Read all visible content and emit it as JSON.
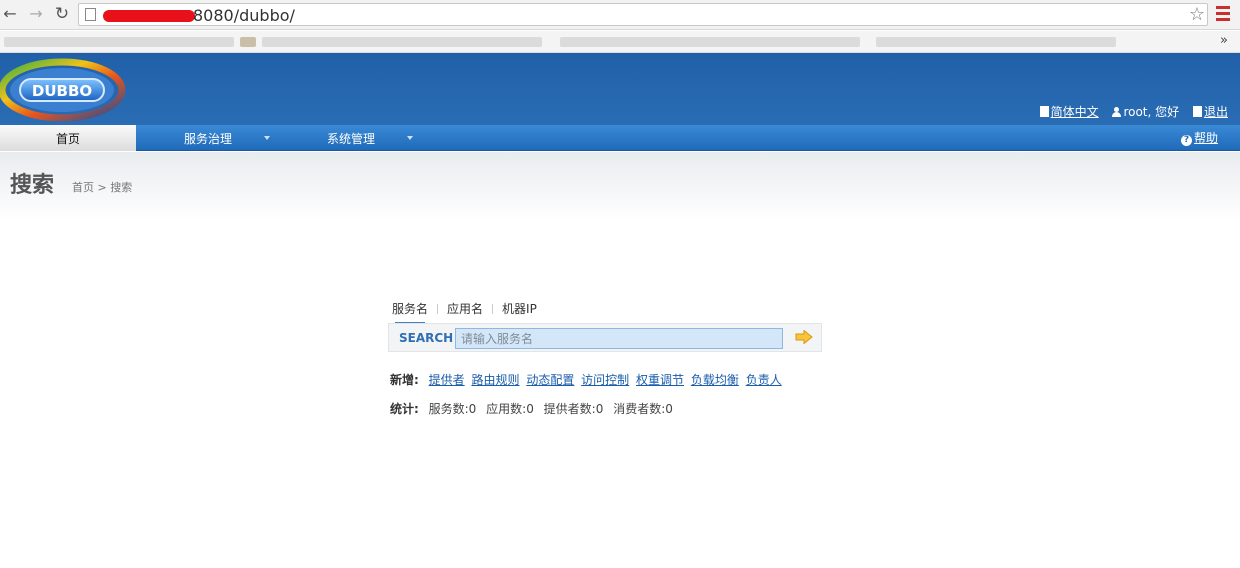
{
  "browser": {
    "url_visible": "8080/dubbo/"
  },
  "header": {
    "logo_text": "DUBBO",
    "lang_link": "简体中文",
    "user_text": "root, 您好",
    "logout_link": "退出"
  },
  "nav": {
    "items": [
      {
        "label": "首页"
      },
      {
        "label": "服务治理"
      },
      {
        "label": "系统管理"
      }
    ],
    "help": "帮助"
  },
  "page": {
    "title": "搜索",
    "breadcrumb": "首页 > 搜索"
  },
  "search": {
    "tabs": [
      {
        "label": "服务名"
      },
      {
        "label": "应用名"
      },
      {
        "label": "机器IP"
      }
    ],
    "label": "SEARCH",
    "placeholder": "请输入服务名"
  },
  "add": {
    "label": "新增:",
    "links": [
      {
        "label": "提供者"
      },
      {
        "label": "路由规则"
      },
      {
        "label": "动态配置"
      },
      {
        "label": "访问控制"
      },
      {
        "label": "权重调节"
      },
      {
        "label": "负载均衡"
      },
      {
        "label": "负责人"
      }
    ]
  },
  "stats": {
    "label": "统计:",
    "items": [
      {
        "label": "服务数:0"
      },
      {
        "label": "应用数:0"
      },
      {
        "label": "提供者数:0"
      },
      {
        "label": "消费者数:0"
      }
    ]
  }
}
